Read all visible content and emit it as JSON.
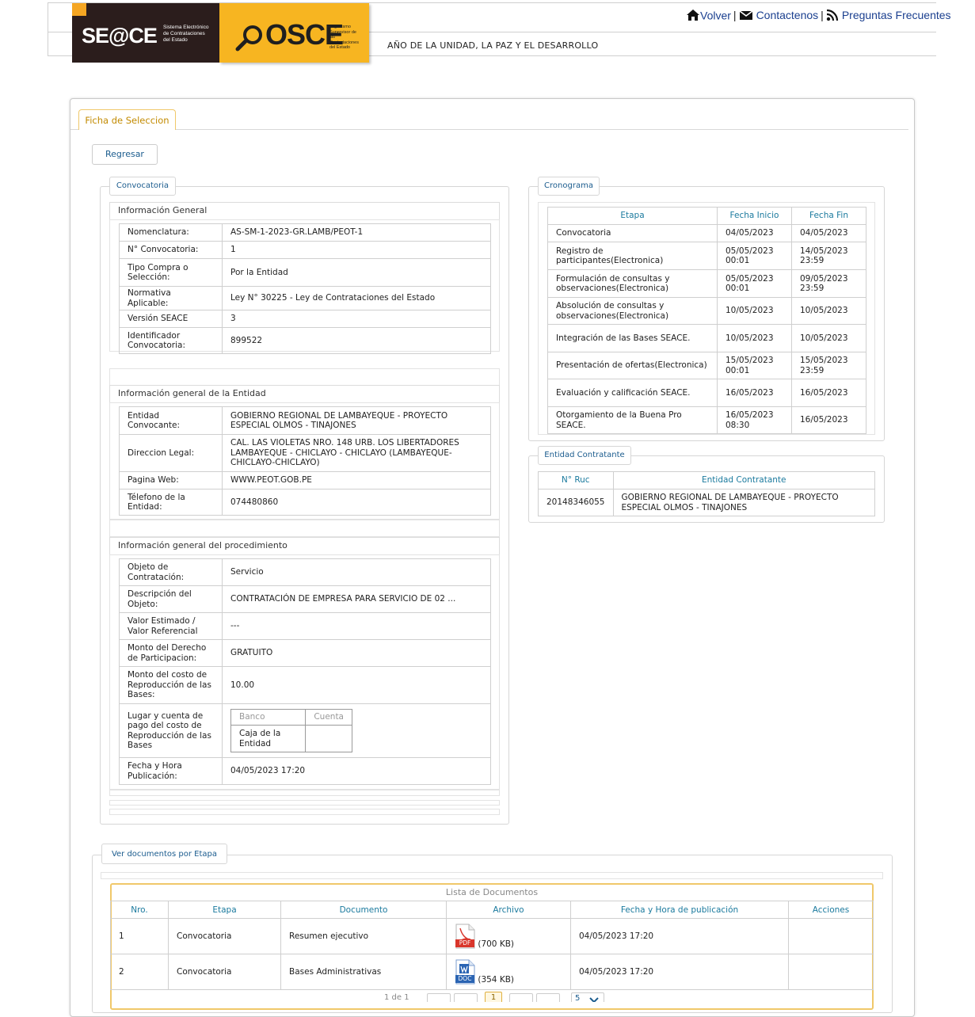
{
  "header": {
    "seace_logo": "SE@CE",
    "seace_sub": "Sistema Electrónico de Contrataciones del Estado",
    "osce_logo": "OSCE",
    "osce_sub": "Organismo Supervisor de las Contrataciones del Estado",
    "links": {
      "volver": "Volver",
      "contactenos": "Contactenos",
      "faq": "Preguntas Frecuentes",
      "sep": "|"
    },
    "motto": "AÑO DE LA UNIDAD, LA PAZ Y EL DESARROLLO"
  },
  "tab": "Ficha de Seleccion",
  "regresar": "Regresar",
  "convocatoria": {
    "legend": "Convocatoria",
    "general": {
      "title": "Información General",
      "rows": [
        {
          "label": "Nomenclatura:",
          "value": "AS-SM-1-2023-GR.LAMB/PEOT-1"
        },
        {
          "label": "N° Convocatoria:",
          "value": "1"
        },
        {
          "label": "Tipo Compra o Selección:",
          "value": "Por la Entidad"
        },
        {
          "label": "Normativa Aplicable:",
          "value": "Ley N° 30225 - Ley de Contrataciones del Estado"
        },
        {
          "label": "Versión SEACE",
          "value": "3"
        },
        {
          "label": "Identificador Convocatoria:",
          "value": "899522"
        }
      ]
    },
    "entidad": {
      "title": "Información general de la Entidad",
      "rows": [
        {
          "label": "Entidad Convocante:",
          "value": "GOBIERNO REGIONAL DE LAMBAYEQUE - PROYECTO ESPECIAL OLMOS - TINAJONES"
        },
        {
          "label": "Direccion Legal:",
          "value": "CAL. LAS VIOLETAS NRO. 148 URB. LOS LIBERTADORES LAMBAYEQUE - CHICLAYO - CHICLAYO (LAMBAYEQUE-CHICLAYO-CHICLAYO)"
        },
        {
          "label": "Pagina Web:",
          "value": "WWW.PEOT.GOB.PE"
        },
        {
          "label": "Télefono de la Entidad:",
          "value": "074480860"
        }
      ]
    },
    "procedimiento": {
      "title": "Información general del procedimiento",
      "rows": [
        {
          "label": "Objeto de Contratación:",
          "value": "Servicio"
        },
        {
          "label": "Descripción del Objeto:",
          "value": "CONTRATACIÓN DE EMPRESA PARA SERVICIO DE 02 ..."
        },
        {
          "label": "Valor Estimado / Valor Referencial",
          "value": "---"
        },
        {
          "label": "Monto del Derecho de Participacion:",
          "value": "GRATUITO"
        },
        {
          "label": "Monto del costo de Reproducción de las Bases:",
          "value": "10.00"
        },
        {
          "label": "Lugar y cuenta de pago del costo de Reproducción de las Bases",
          "value": ""
        },
        {
          "label": "Fecha y Hora Publicación:",
          "value": "04/05/2023 17:20"
        }
      ],
      "pago": {
        "banco_ph": "Banco",
        "cuenta_ph": "Cuenta",
        "banco": "Caja de la Entidad",
        "cuenta": ""
      }
    }
  },
  "cronograma": {
    "legend": "Cronograma",
    "headers": [
      "Etapa",
      "Fecha Inicio",
      "Fecha Fin"
    ],
    "rows": [
      {
        "etapa": "Convocatoria",
        "inicio": "04/05/2023",
        "fin": "04/05/2023"
      },
      {
        "etapa": "Registro de participantes(Electronica)",
        "inicio": "05/05/2023 00:01",
        "fin": "14/05/2023 23:59"
      },
      {
        "etapa": "Formulación de consultas y observaciones(Electronica)",
        "inicio": "05/05/2023 00:01",
        "fin": "09/05/2023 23:59"
      },
      {
        "etapa": "Absolución de consultas y observaciones(Electronica)",
        "inicio": "10/05/2023",
        "fin": "10/05/2023"
      },
      {
        "etapa": "Integración de las Bases SEACE.",
        "inicio": "10/05/2023",
        "fin": "10/05/2023"
      },
      {
        "etapa": "Presentación de ofertas(Electronica)",
        "inicio": "15/05/2023 00:01",
        "fin": "15/05/2023 23:59"
      },
      {
        "etapa": "Evaluación y calificación SEACE.",
        "inicio": "16/05/2023",
        "fin": "16/05/2023"
      },
      {
        "etapa": "Otorgamiento de la Buena Pro SEACE.",
        "inicio": "16/05/2023 08:30",
        "fin": "16/05/2023"
      }
    ]
  },
  "contratante": {
    "legend": "Entidad Contratante",
    "headers": [
      "N° Ruc",
      "Entidad Contratante"
    ],
    "ruc": "20148346055",
    "nombre": "GOBIERNO REGIONAL DE LAMBAYEQUE - PROYECTO ESPECIAL OLMOS - TINAJONES"
  },
  "documentos": {
    "legend": "Ver documentos por Etapa",
    "caption": "Lista de Documentos",
    "headers": [
      "Nro.",
      "Etapa",
      "Documento",
      "Archivo",
      "Fecha y Hora de publicación",
      "Acciones"
    ],
    "rows": [
      {
        "nro": "1",
        "etapa": "Convocatoria",
        "documento": "Resumen ejecutivo",
        "icon": "PDF",
        "size": "(700 KB)",
        "fecha": "04/05/2023 17:20"
      },
      {
        "nro": "2",
        "etapa": "Convocatoria",
        "documento": "Bases Administrativas",
        "icon": "DOC",
        "size": "(354 KB)",
        "fecha": "04/05/2023 17:20"
      }
    ],
    "pager": {
      "info": "1 de 1",
      "page": "1",
      "per_page": "5"
    }
  },
  "colors": {
    "accent": "#1b5c8e",
    "tab_gold": "#c28a00",
    "osce_yellow": "#f7b521",
    "seace_dark": "#2b1d1c",
    "pdf_red": "#d9362b",
    "doc_blue": "#2a64b3"
  }
}
